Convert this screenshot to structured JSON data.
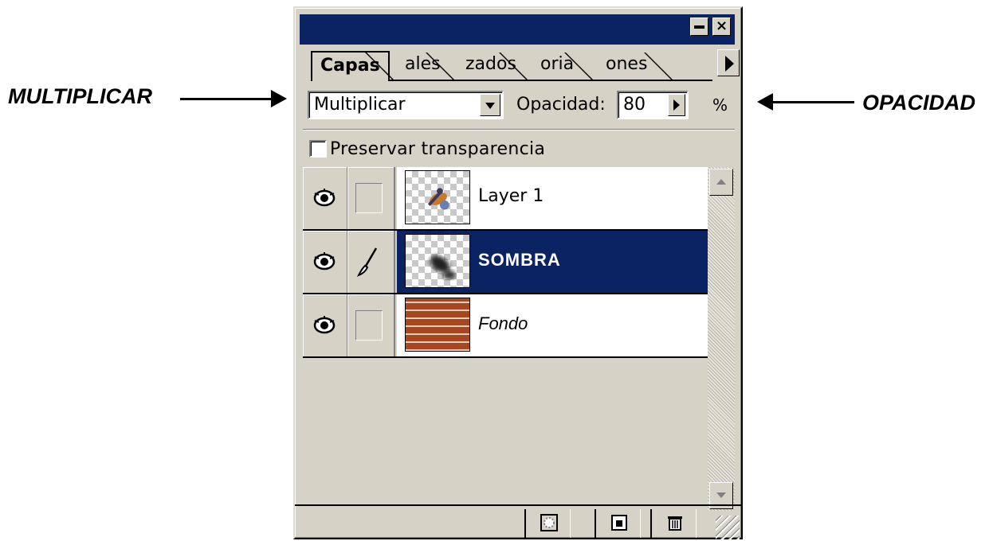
{
  "annotations": {
    "left_label": "MULTIPLICAR",
    "right_label": "OPACIDAD"
  },
  "window": {
    "minimize_icon": "minimize-icon",
    "close_icon": "close-icon"
  },
  "tabs": [
    {
      "label": "Capas",
      "active": true
    },
    {
      "label": "ales",
      "active": false
    },
    {
      "label": "zados",
      "active": false
    },
    {
      "label": "oria",
      "active": false
    },
    {
      "label": "ones",
      "active": false
    }
  ],
  "blend_mode": {
    "value": "Multiplicar"
  },
  "opacity": {
    "label": "Opacidad:",
    "value": "80",
    "unit": "%"
  },
  "preserve_transparency": {
    "label": "Preservar transparencia",
    "checked": false
  },
  "layers": [
    {
      "name": "Layer 1",
      "visible": true,
      "selected": false,
      "brush": false,
      "thumbnail": "character-thumbnail"
    },
    {
      "name": "SOMBRA",
      "visible": true,
      "selected": true,
      "brush": true,
      "thumbnail": "shadow-thumbnail"
    },
    {
      "name": "Fondo",
      "visible": true,
      "selected": false,
      "brush": false,
      "thumbnail": "bricks-thumbnail"
    }
  ],
  "colors": {
    "selection": "#0a2463",
    "panel_bg": "#d6d3c6"
  },
  "bottom_icons": [
    "mask-icon",
    "new-layer-icon",
    "trash-icon"
  ]
}
